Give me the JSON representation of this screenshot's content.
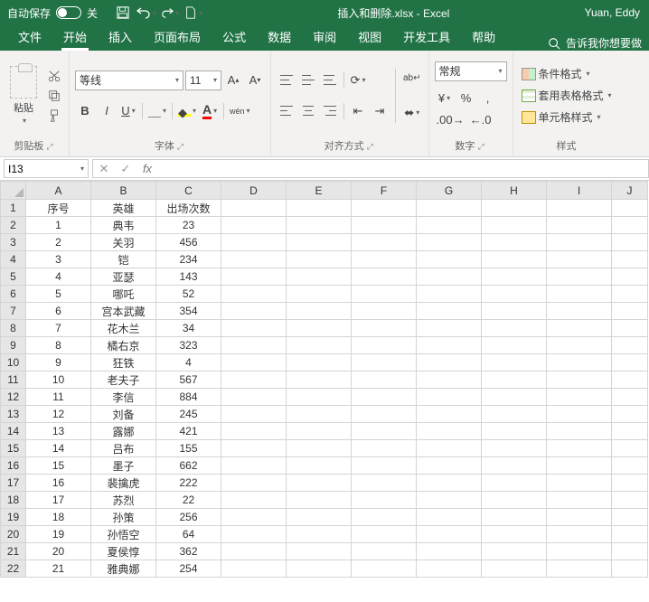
{
  "titlebar": {
    "autosave_label": "自动保存",
    "autosave_state": "关",
    "filename": "插入和删除.xlsx  -  Excel",
    "username": "Yuan, Eddy"
  },
  "tabs": {
    "file": "文件",
    "home": "开始",
    "insert": "插入",
    "page_layout": "页面布局",
    "formulas": "公式",
    "data": "数据",
    "review": "审阅",
    "view": "视图",
    "developer": "开发工具",
    "help": "帮助",
    "tellme": "告诉我你想要做"
  },
  "ribbon": {
    "clipboard": {
      "label": "剪贴板",
      "paste": "粘贴"
    },
    "font": {
      "label": "字体",
      "name": "等线",
      "size": "11",
      "bold": "B",
      "italic": "I",
      "underline": "U",
      "ruby": "wén"
    },
    "align": {
      "label": "对齐方式"
    },
    "number": {
      "label": "数字",
      "format": "常规",
      "currency": "%",
      "comma": ","
    },
    "styles": {
      "label": "样式",
      "cond_format": "条件格式",
      "table_format": "套用表格格式",
      "cell_style": "单元格样式"
    }
  },
  "formula_bar": {
    "namebox": "I13",
    "fx": "fx"
  },
  "columns": [
    "A",
    "B",
    "C",
    "D",
    "E",
    "F",
    "G",
    "H",
    "I",
    "J"
  ],
  "headers": {
    "A": "序号",
    "B": "英雄",
    "C": "出场次数"
  },
  "rows": [
    {
      "n": 1,
      "A": "1",
      "B": "典韦",
      "C": "23"
    },
    {
      "n": 2,
      "A": "2",
      "B": "关羽",
      "C": "456"
    },
    {
      "n": 3,
      "A": "3",
      "B": "铠",
      "C": "234"
    },
    {
      "n": 4,
      "A": "4",
      "B": "亚瑟",
      "C": "143"
    },
    {
      "n": 5,
      "A": "5",
      "B": "哪吒",
      "C": "52"
    },
    {
      "n": 6,
      "A": "6",
      "B": "宫本武藏",
      "C": "354"
    },
    {
      "n": 7,
      "A": "7",
      "B": "花木兰",
      "C": "34"
    },
    {
      "n": 8,
      "A": "8",
      "B": "橘右京",
      "C": "323"
    },
    {
      "n": 9,
      "A": "9",
      "B": "狂铁",
      "C": "4"
    },
    {
      "n": 10,
      "A": "10",
      "B": "老夫子",
      "C": "567"
    },
    {
      "n": 11,
      "A": "11",
      "B": "李信",
      "C": "884"
    },
    {
      "n": 12,
      "A": "12",
      "B": "刘备",
      "C": "245"
    },
    {
      "n": 13,
      "A": "13",
      "B": "露娜",
      "C": "421"
    },
    {
      "n": 14,
      "A": "14",
      "B": "吕布",
      "C": "155"
    },
    {
      "n": 15,
      "A": "15",
      "B": "墨子",
      "C": "662"
    },
    {
      "n": 16,
      "A": "16",
      "B": "裴擒虎",
      "C": "222"
    },
    {
      "n": 17,
      "A": "17",
      "B": "苏烈",
      "C": "22"
    },
    {
      "n": 18,
      "A": "18",
      "B": "孙策",
      "C": "256"
    },
    {
      "n": 19,
      "A": "19",
      "B": "孙悟空",
      "C": "64"
    },
    {
      "n": 20,
      "A": "20",
      "B": "夏侯惇",
      "C": "362"
    },
    {
      "n": 21,
      "A": "21",
      "B": "雅典娜",
      "C": "254"
    }
  ]
}
